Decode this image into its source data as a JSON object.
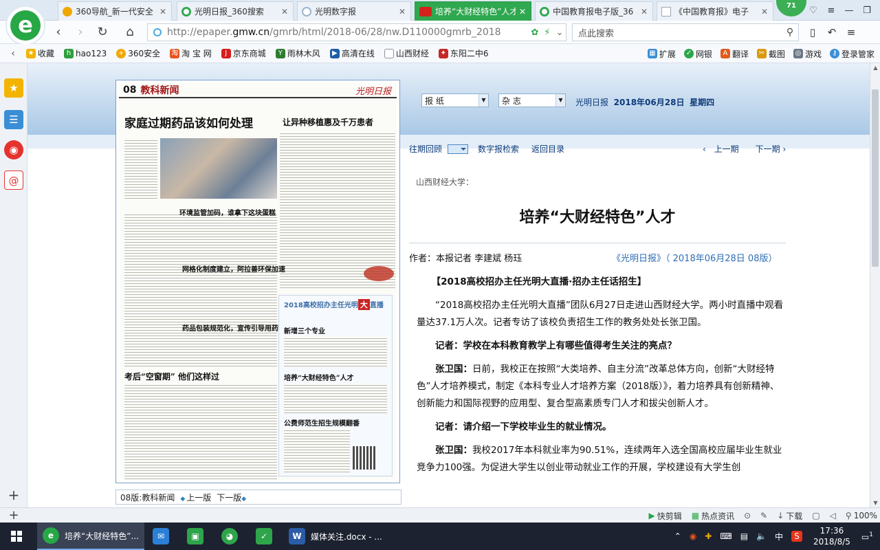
{
  "browser": {
    "tabs": [
      {
        "label": "360导航_新一代安全",
        "color": "#f0a700"
      },
      {
        "label": "光明日报_360搜索",
        "color": "#33a852"
      },
      {
        "label": "光明数字报",
        "color": "#9bb4cc"
      },
      {
        "label": "培养“大财经特色”人才",
        "color": "#d6221c",
        "active": true
      },
      {
        "label": "中国教育报电子版_36",
        "color": "#33a852"
      },
      {
        "label": "《中国教育报》电子",
        "color": "#9aa4ae"
      }
    ],
    "badge": "71",
    "url_prefix": "http://epaper.",
    "url_domain": "gmw.cn",
    "url_rest": "/gmrb/html/2018-06/28/nw.D110000gmrb_2018",
    "search_placeholder": "点此搜索",
    "logo_letter": "e",
    "bookmarks": [
      {
        "label": "收藏",
        "icon": "star-icon",
        "color": "#f2b400"
      },
      {
        "label": "hao123",
        "icon": "hao-icon",
        "color": "#2e9e3e"
      },
      {
        "label": "360安全",
        "icon": "360-icon",
        "color": "#f0a700"
      },
      {
        "label": "淘 宝 网",
        "icon": "taobao-icon",
        "color": "#e8541e"
      },
      {
        "label": "京东商城",
        "icon": "jd-icon",
        "color": "#d71c1c"
      },
      {
        "label": "雨林木风",
        "icon": "tree-icon",
        "color": "#2f7d32"
      },
      {
        "label": "高清在线",
        "icon": "video-icon",
        "color": "#1e5fa8"
      },
      {
        "label": "山西财经",
        "icon": "page-icon",
        "color": "#8a949e"
      },
      {
        "label": "东阳二中6",
        "icon": "flag-icon",
        "color": "#c62828"
      }
    ],
    "bookmark_tools": [
      "扩展",
      "网银",
      "翻译",
      "截图",
      "游戏",
      "登录管家"
    ]
  },
  "page": {
    "paper_select": "报 纸",
    "magazine_select": "杂 志",
    "paper_name": "光明日报",
    "paper_date": "2018年06月28日",
    "paper_weekday": "星期四",
    "subnav": [
      "往期回顾",
      "数字报检索",
      "返回目录"
    ],
    "prev_page": "上一期",
    "next_page": "下一期",
    "kicker": "山西财经大学：",
    "headline": "培养“大财经特色”人才",
    "byline": "作者：本报记者 李建斌 杨珏",
    "source": "《光明日报》（ 2018年06月28日 08版）",
    "body": {
      "section": "【2018高校招办主任光明大直播·招办主任话招生】",
      "p1": "“2018高校招办主任光明大直播”团队6月27日走进山西财经大学。两小时直播中观看量达37.1万人次。记者专访了该校负责招生工作的教务处处长张卫国。",
      "q1": "记者：学校在本科教育教学上有哪些值得考生关注的亮点？",
      "a1_speaker": "张卫国：",
      "a1": "日前，我校正在按照“大类培养、自主分流”改革总体方向，创新“大财经特色”人才培养模式，制定《本科专业人才培养方案（2018版）》，着力培养具有创新精神、创新能力和国际视野的应用型、复合型高素质专门人才和拔尖创新人才。",
      "q2": "记者：请介绍一下学校毕业生的就业情况。",
      "a2_speaker": "张卫国：",
      "a2": "我校2017年本科就业率为90.51%，连续两年入选全国高校应届毕业生就业竞争力100强。为促进大学生以创业带动就业工作的开展，学校建设有大学生创"
    },
    "newspaper": {
      "page_no": "08",
      "section": "教科新闻",
      "masthead": "光明日报",
      "title": "家庭过期药品该如何处理",
      "title2": "让异种移植惠及千万患者",
      "sub1": "环境监管加码，谁拿下这块蛋糕",
      "sub2": "网格化制度建立，阿拉善环保加速",
      "sub3": "药品包装规范化，宣传引导用药",
      "title3": "考后“空窗期” 他们这样过",
      "box_head": "2018高校招办主任光明",
      "box_big": "大",
      "box_tail": "直播",
      "box_sub1": "新增三个专业",
      "box_sub2": "培养“大财经特色”人才",
      "box_sub3": "公费师范生招生规模翻番"
    },
    "footer": {
      "label": "08版:教科新闻",
      "prev": "上一版",
      "next": "下一版"
    }
  },
  "statusbar": [
    "快剪辑",
    "热点资讯",
    "下载",
    "100%"
  ],
  "taskbar": {
    "items": [
      {
        "label": "培养“大财经特色”...",
        "color": "#27a745"
      },
      {
        "label": "",
        "color": "#2b7fd6"
      },
      {
        "label": "",
        "color": "#2ea54a"
      },
      {
        "label": "",
        "color": "#2ea54a"
      },
      {
        "label": "",
        "color": "#2ea54a"
      },
      {
        "label": "媒体关注.docx - ...",
        "color": "#2b5ca8"
      }
    ],
    "ime": "中",
    "time": "17:36",
    "date": "2018/8/5",
    "notify": "1"
  }
}
